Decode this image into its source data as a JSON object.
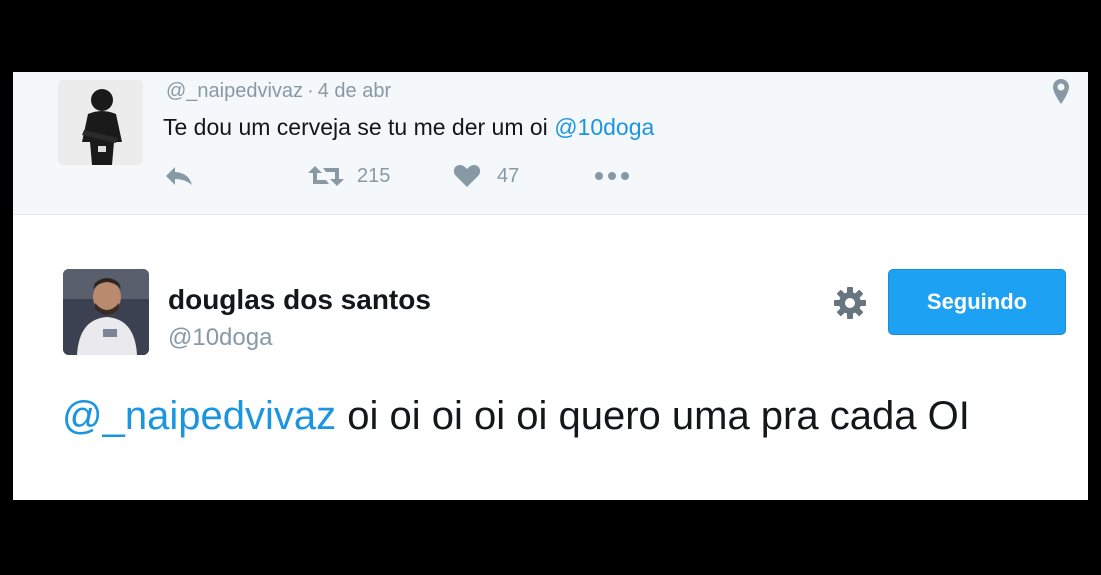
{
  "parent_tweet": {
    "handle": "@_naipedvivaz",
    "separator": "·",
    "date": "4 de abr",
    "text": "Te dou um cerveja se tu me der um oi ",
    "mention": "@10doga",
    "retweets": "215",
    "likes": "47",
    "icons": [
      "reply-icon",
      "retweet-icon",
      "heart-icon",
      "more-icon",
      "location-pin-icon"
    ]
  },
  "focused_tweet": {
    "name": "douglas dos santos",
    "handle": "@10doga",
    "follow_label": "Seguindo",
    "mention": "@_naipedvivaz",
    "text": " oi oi oi oi oi quero uma pra cada OI"
  },
  "colors": {
    "accent": "#1da1f2",
    "mention": "#1b95e0",
    "muted": "#8899a6",
    "parent_bg": "#f5f8fa"
  }
}
